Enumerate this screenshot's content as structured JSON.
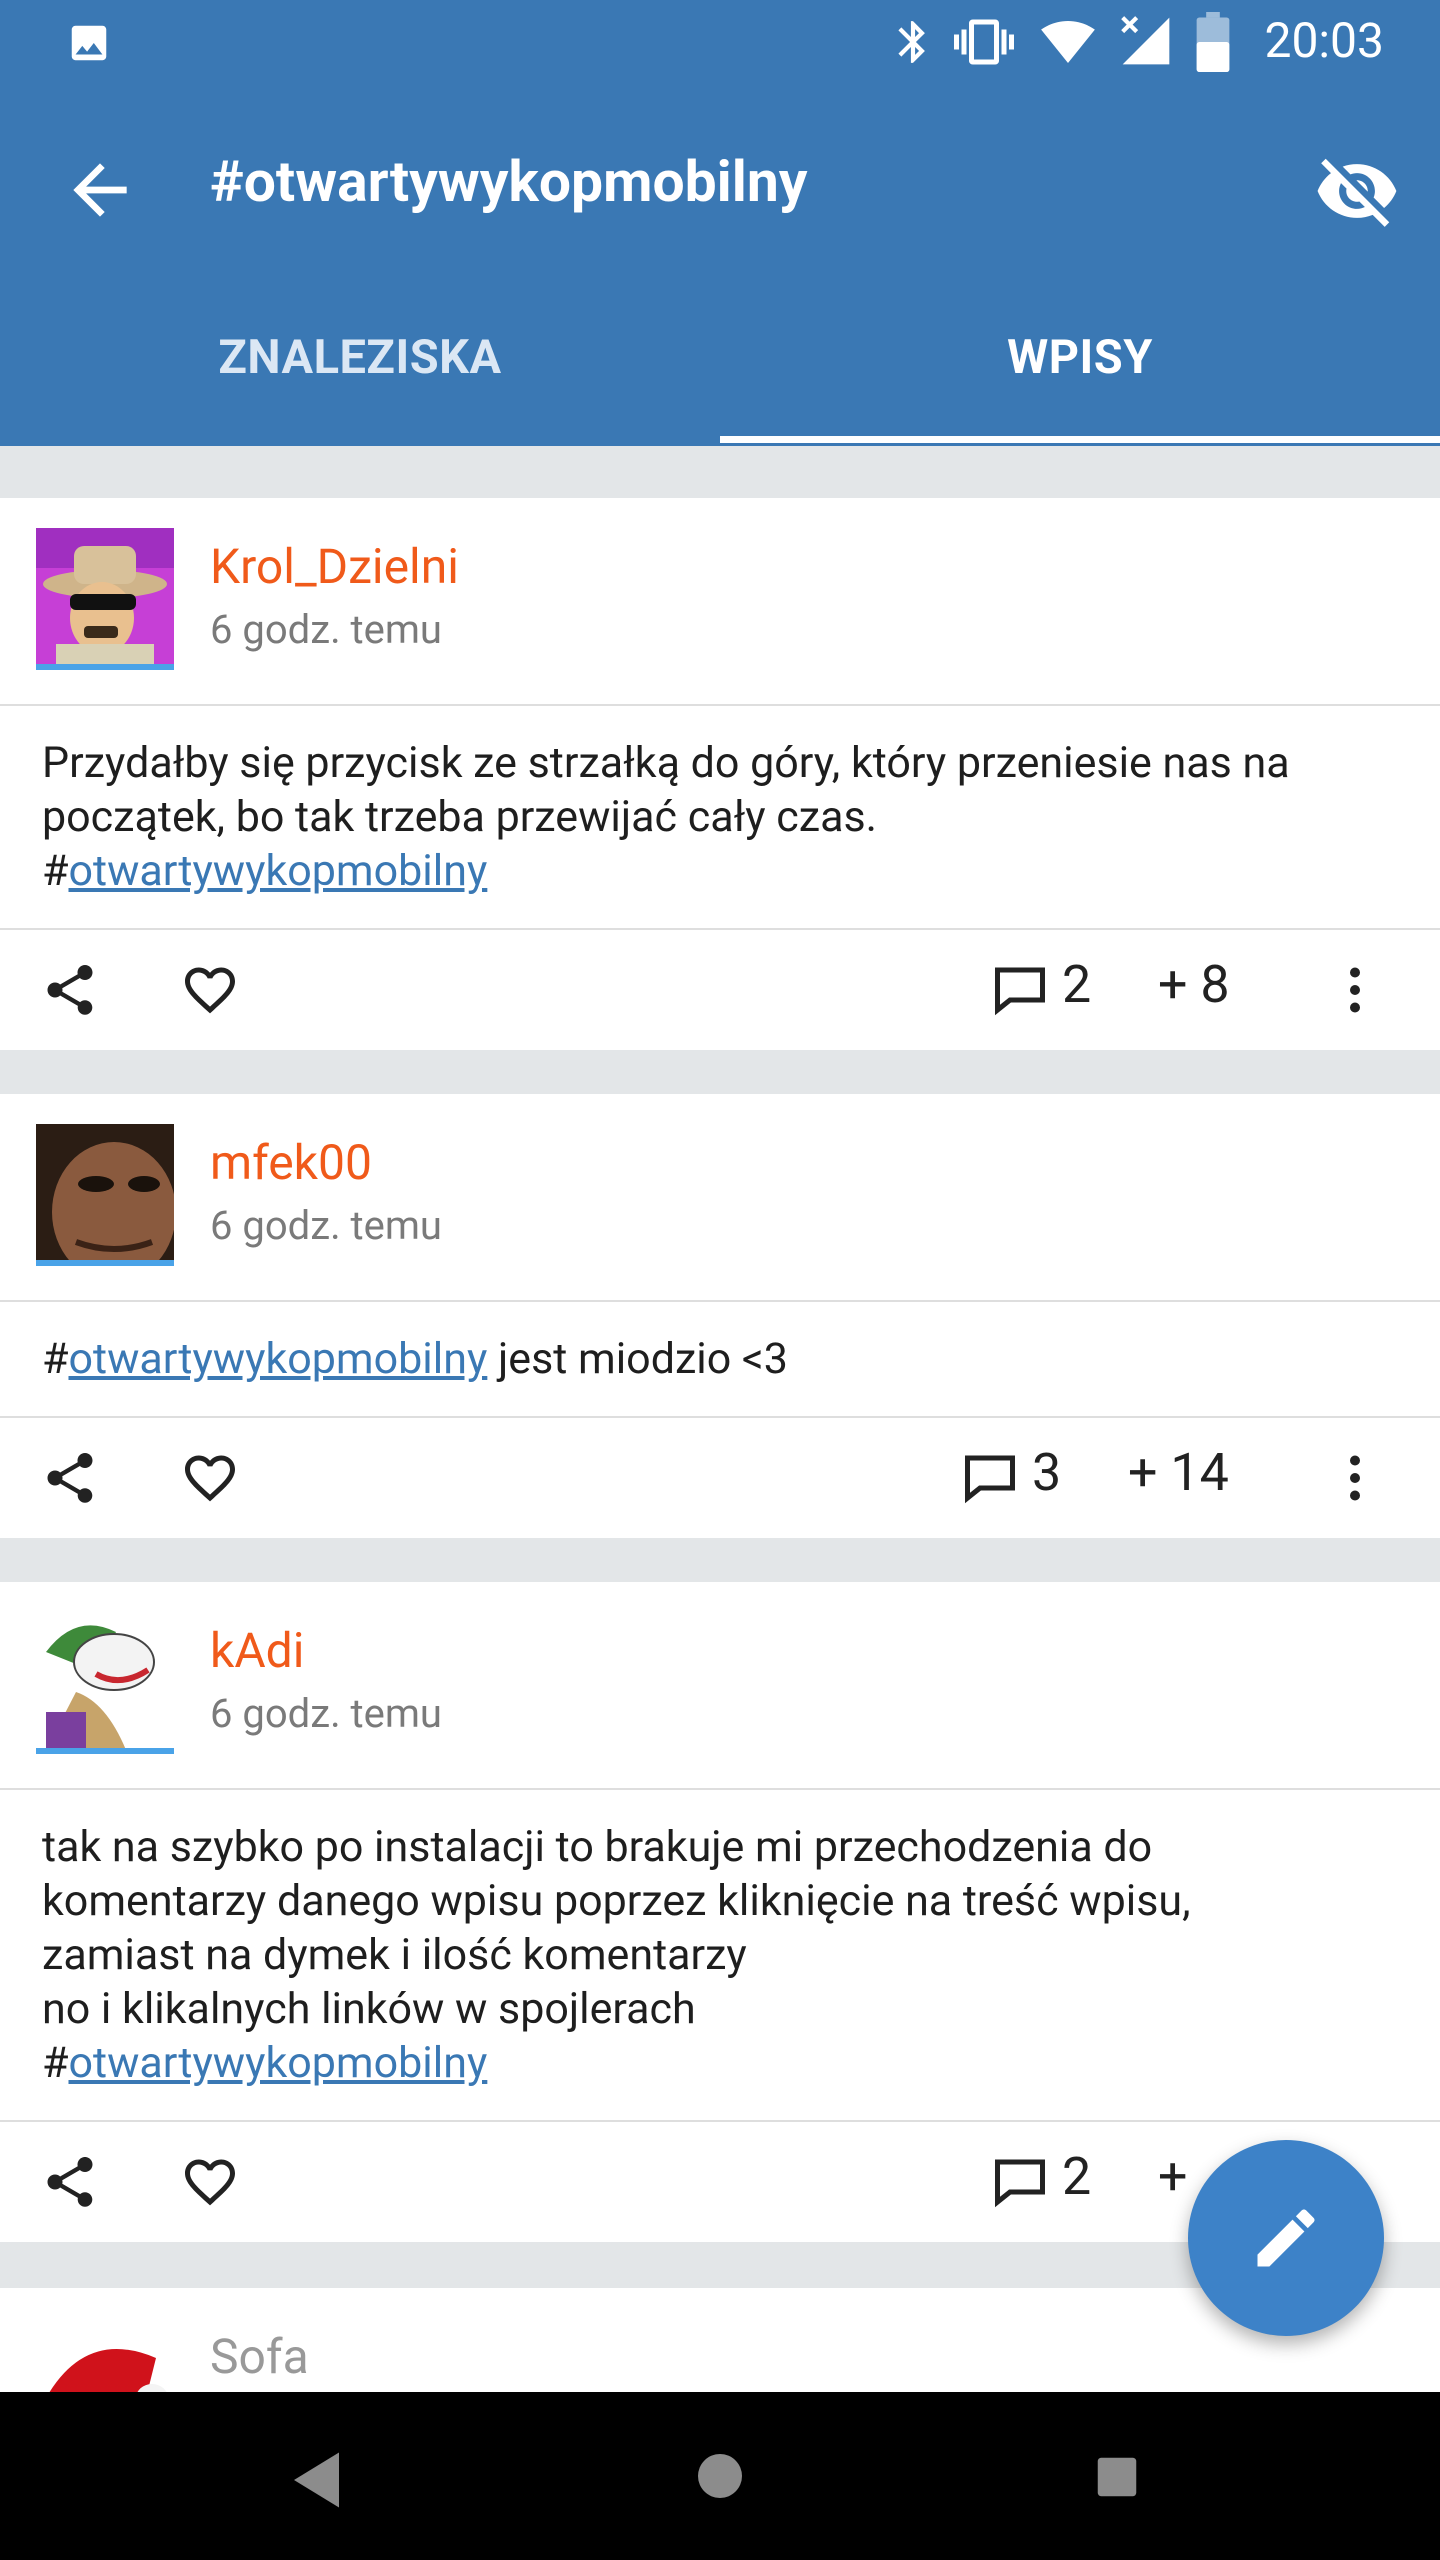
{
  "status_bar": {
    "time": "20:03"
  },
  "toolbar": {
    "title": "#otwartywykopmobilny"
  },
  "tabs": [
    {
      "label": "ZNALEZISKA",
      "active": false
    },
    {
      "label": "WPISY",
      "active": true
    }
  ],
  "posts": [
    {
      "author": "Krol_Dzielni",
      "time_ago": "6 godz. temu",
      "lines": [
        "Przydałby się przycisk ze strzałką do góry, który przeniesie nas na",
        "początek, bo tak trzeba przewijać cały czas."
      ],
      "tag": "otwartywykopmobilny",
      "comments": "2",
      "votes": "+ 8"
    },
    {
      "author": "mfek00",
      "time_ago": "6 godz. temu",
      "tag": "otwartywykopmobilny",
      "tail": " jest miodzio <3",
      "comments": "3",
      "votes": "+ 14"
    },
    {
      "author": "kAdi",
      "time_ago": "6 godz. temu",
      "lines": [
        "tak na szybko po instalacji to brakuje mi przechodzenia do",
        "komentarzy danego wpisu poprzez kliknięcie na treść wpisu,",
        "zamiast na dymek i ilość komentarzy",
        "no i klikalnych linków w spojlerach"
      ],
      "tag": "otwartywykopmobilny",
      "comments": "2",
      "votes": "+"
    },
    {
      "author": "Sofa"
    }
  ],
  "colors": {
    "header": "#3a78b4",
    "author": "#f05a1a",
    "link": "#3a78b4",
    "fab": "#3d82c8"
  },
  "icons": [
    "image-icon",
    "bluetooth-icon",
    "vibrate-icon",
    "wifi-icon",
    "signal-icon",
    "battery-icon",
    "back-arrow-icon",
    "hide-eye-icon",
    "share-icon",
    "heart-icon",
    "comment-icon",
    "more-vert-icon",
    "pencil-icon",
    "nav-back-icon",
    "nav-home-icon",
    "nav-recents-icon"
  ]
}
